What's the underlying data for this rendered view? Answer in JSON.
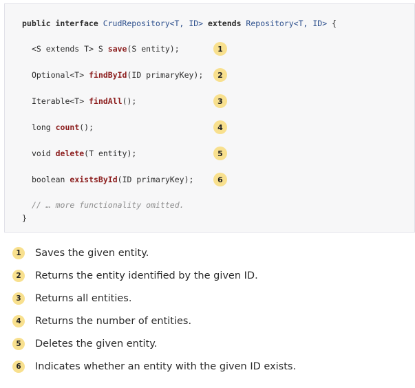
{
  "code": {
    "header": {
      "prefix": "public interface ",
      "type1": "CrudRepository<T, ID>",
      "mid": " extends ",
      "type2": "Repository<T, ID>",
      "suffix": " {"
    },
    "lines": [
      {
        "pre": "<S extends T> S ",
        "method": "save",
        "post": "(S entity);",
        "callout": "1"
      },
      {
        "pre": "Optional<T> ",
        "method": "findById",
        "post": "(ID primaryKey);",
        "callout": "2"
      },
      {
        "pre": "Iterable<T> ",
        "method": "findAll",
        "post": "();",
        "callout": "3"
      },
      {
        "pre": "long ",
        "method": "count",
        "post": "();",
        "callout": "4"
      },
      {
        "pre": "void ",
        "method": "delete",
        "post": "(T entity);",
        "callout": "5"
      },
      {
        "pre": "boolean ",
        "method": "existsById",
        "post": "(ID primaryKey);",
        "callout": "6"
      }
    ],
    "comment": "// … more functionality omitted.",
    "closing": "}"
  },
  "callout_list": [
    {
      "number": "1",
      "text": "Saves the given entity."
    },
    {
      "number": "2",
      "text": "Returns the entity identified by the given ID."
    },
    {
      "number": "3",
      "text": "Returns all entities."
    },
    {
      "number": "4",
      "text": "Returns the number of entities."
    },
    {
      "number": "5",
      "text": "Deletes the given entity."
    },
    {
      "number": "6",
      "text": "Indicates whether an entity with the given ID exists."
    }
  ],
  "colors": {
    "callout_bg": "#f8e08e",
    "method": "#8b1c1c",
    "type": "#2b4e8c",
    "code_bg": "#f7f7f8"
  }
}
